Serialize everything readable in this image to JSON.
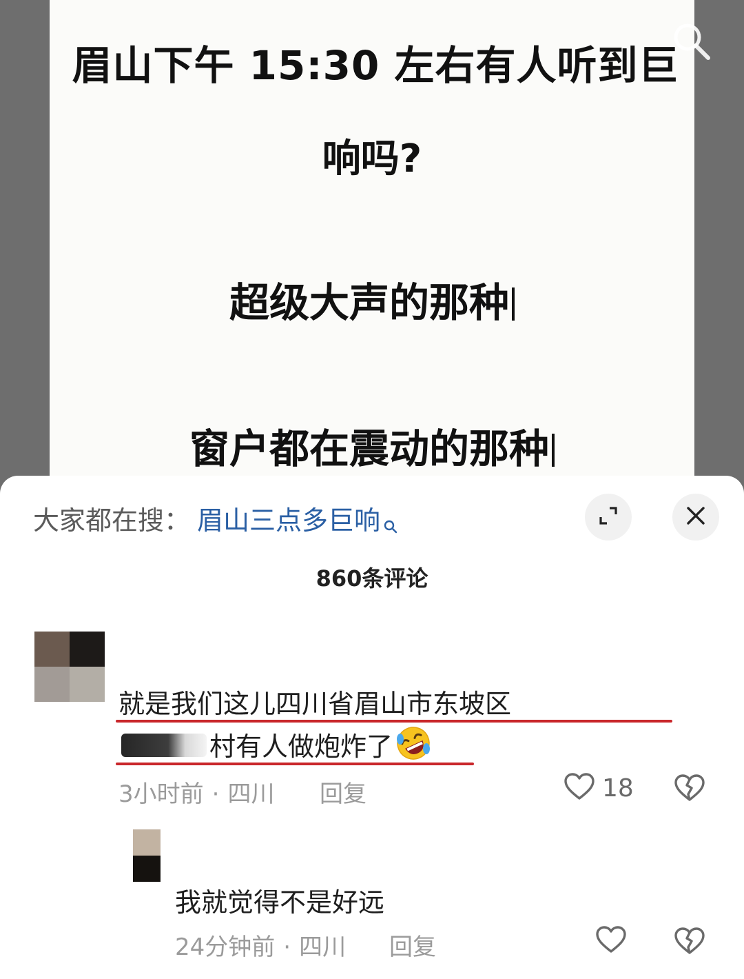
{
  "video": {
    "line1": "眉山下午  15:30  左右有人听到巨",
    "line2": "响吗?",
    "line3": "超级大声的那种",
    "line4": "窗户都在震动的那种"
  },
  "sheet": {
    "search_prefix": "大家都在搜：",
    "search_term": "眉山三点多巨响",
    "comment_count": "860条评论"
  },
  "comments": [
    {
      "text_line1": "就是我们这儿四川省眉山市东坡区",
      "text_line2": "村有人做炮炸了",
      "time": "3小时前",
      "location": "四川",
      "reply_label": "回复",
      "likes": "18",
      "emoji": "rolling-on-floor-laughing"
    },
    {
      "text": "我就觉得不是好远",
      "time": "24分钟前",
      "location": "四川",
      "reply_label": "回复"
    }
  ],
  "colors": {
    "accent_link": "#2a5fa4",
    "underline": "#c9272b",
    "meta_text": "#9b9b9b"
  },
  "icons": [
    "search-icon",
    "expand-icon",
    "close-icon",
    "heart-icon",
    "broken-heart-icon"
  ]
}
